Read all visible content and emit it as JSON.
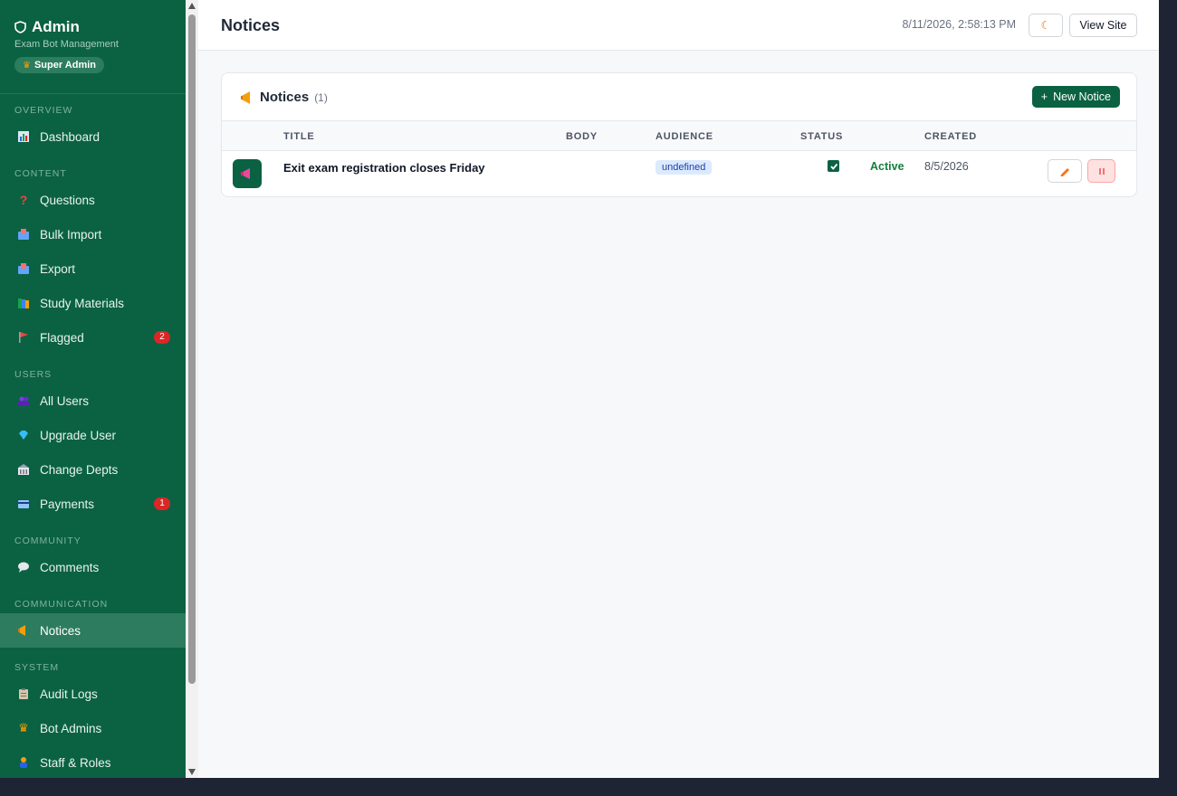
{
  "brand": {
    "title": "Admin",
    "subtitle": "Exam Bot Management",
    "role": "Super Admin"
  },
  "sidebar": {
    "sections": [
      {
        "label": "OVERVIEW"
      },
      {
        "label": "CONTENT"
      },
      {
        "label": "USERS"
      },
      {
        "label": "COMMUNITY"
      },
      {
        "label": "COMMUNICATION"
      },
      {
        "label": "SYSTEM"
      }
    ],
    "items": [
      {
        "label": "Dashboard",
        "icon": "chart-icon"
      },
      {
        "label": "Questions",
        "icon": "question-icon"
      },
      {
        "label": "Bulk Import",
        "icon": "inbox-icon"
      },
      {
        "label": "Export",
        "icon": "outbox-icon"
      },
      {
        "label": "Study Materials",
        "icon": "books-icon"
      },
      {
        "label": "Flagged",
        "icon": "flag-icon",
        "badge": "2"
      },
      {
        "label": "All Users",
        "icon": "users-icon"
      },
      {
        "label": "Upgrade User",
        "icon": "gem-icon"
      },
      {
        "label": "Change Depts",
        "icon": "building-icon"
      },
      {
        "label": "Payments",
        "icon": "card-icon",
        "badge": "1"
      },
      {
        "label": "Comments",
        "icon": "speech-icon"
      },
      {
        "label": "Notices",
        "icon": "megaphone-icon",
        "active": true
      },
      {
        "label": "Audit Logs",
        "icon": "clipboard-icon"
      },
      {
        "label": "Bot Admins",
        "icon": "crown-icon"
      },
      {
        "label": "Staff & Roles",
        "icon": "person-icon"
      }
    ]
  },
  "header": {
    "title": "Notices",
    "datetime": "8/11/2026, 2:58:13 PM",
    "view_site": "View Site"
  },
  "card": {
    "title": "Notices",
    "count": "(1)",
    "new_button": "New Notice",
    "columns": [
      "TITLE",
      "BODY",
      "AUDIENCE",
      "STATUS",
      "CREATED"
    ],
    "rows": [
      {
        "title": "Exit exam registration closes Friday",
        "body": "",
        "audience": "undefined",
        "active": true,
        "status": "Active",
        "created": "8/5/2026"
      }
    ]
  },
  "colors": {
    "sidebar": "#0b6243",
    "accent": "#0b6243",
    "active_item": "#2e7c5f",
    "badge": "#dc2626"
  }
}
